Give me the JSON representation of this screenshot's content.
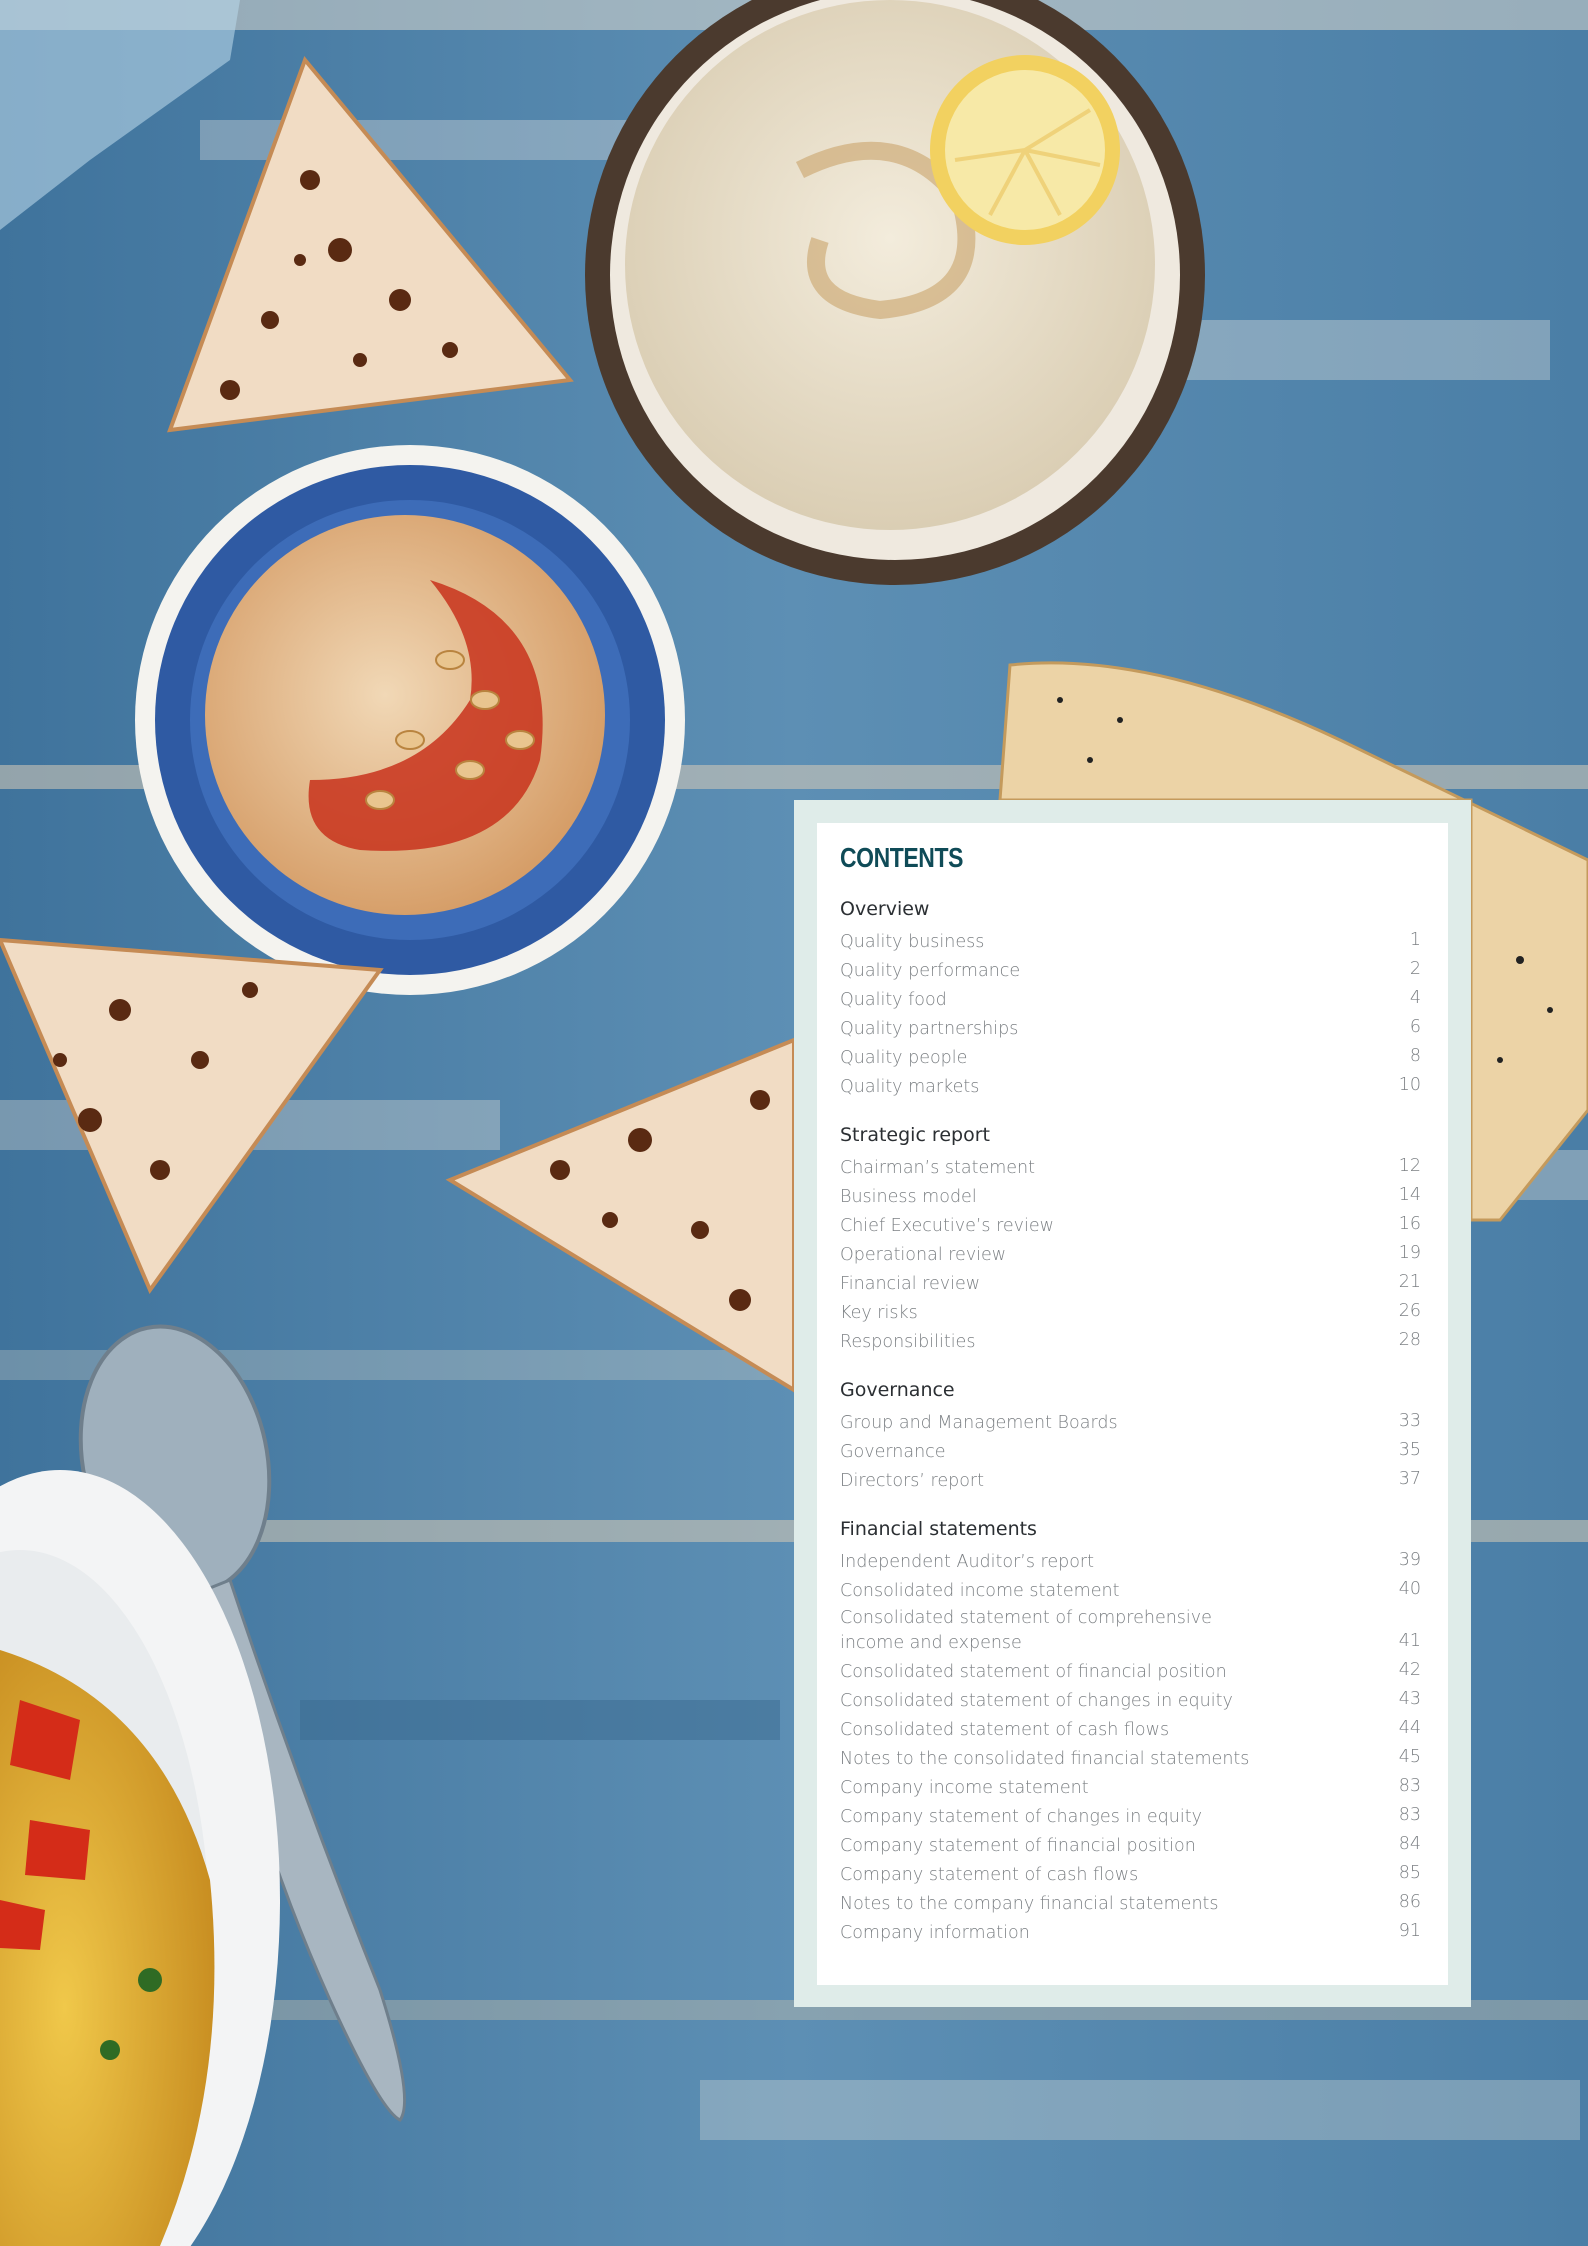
{
  "contents": {
    "title": "CONTENTS",
    "sections": [
      {
        "heading": "Overview",
        "entries": [
          {
            "label": "Quality business",
            "page": "1"
          },
          {
            "label": "Quality performance",
            "page": "2"
          },
          {
            "label": "Quality food",
            "page": "4"
          },
          {
            "label": "Quality partnerships",
            "page": "6"
          },
          {
            "label": "Quality people",
            "page": "8"
          },
          {
            "label": "Quality markets",
            "page": "10"
          }
        ]
      },
      {
        "heading": "Strategic report",
        "entries": [
          {
            "label": "Chairman’s statement",
            "page": "12"
          },
          {
            "label": "Business model",
            "page": "14"
          },
          {
            "label": "Chief Executive’s review",
            "page": "16"
          },
          {
            "label": "Operational review",
            "page": "19"
          },
          {
            "label": "Financial review",
            "page": "21"
          },
          {
            "label": "Key risks",
            "page": "26"
          },
          {
            "label": "Responsibilities",
            "page": "28"
          }
        ]
      },
      {
        "heading": "Governance",
        "entries": [
          {
            "label": "Group and Management Boards",
            "page": "33"
          },
          {
            "label": "Governance",
            "page": "35"
          },
          {
            "label": "Directors’ report",
            "page": "37"
          }
        ]
      },
      {
        "heading": "Financial statements",
        "entries": [
          {
            "label": "Independent Auditor’s report",
            "page": "39"
          },
          {
            "label": "Consolidated income statement",
            "page": "40"
          },
          {
            "label": "Consolidated statement of comprehensive income and expense",
            "page": "41"
          },
          {
            "label": "Consolidated statement of financial position",
            "page": "42"
          },
          {
            "label": "Consolidated statement of changes in equity",
            "page": "43"
          },
          {
            "label": "Consolidated statement of cash flows",
            "page": "44"
          },
          {
            "label": "Notes to the consolidated financial statements",
            "page": "45"
          },
          {
            "label": "Company income statement",
            "page": "83"
          },
          {
            "label": "Company statement of changes in equity",
            "page": "83"
          },
          {
            "label": "Company statement of financial position",
            "page": "84"
          },
          {
            "label": "Company statement of cash flows",
            "page": "85"
          },
          {
            "label": "Notes to the company financial statements",
            "page": "86"
          },
          {
            "label": "Company information",
            "page": "91"
          }
        ]
      }
    ]
  },
  "colors": {
    "title": "#0f4b57",
    "frame": "#dfece9",
    "heading": "#2b2f33",
    "entry": "#7c8084",
    "table_wood": "#4a7fa6"
  }
}
